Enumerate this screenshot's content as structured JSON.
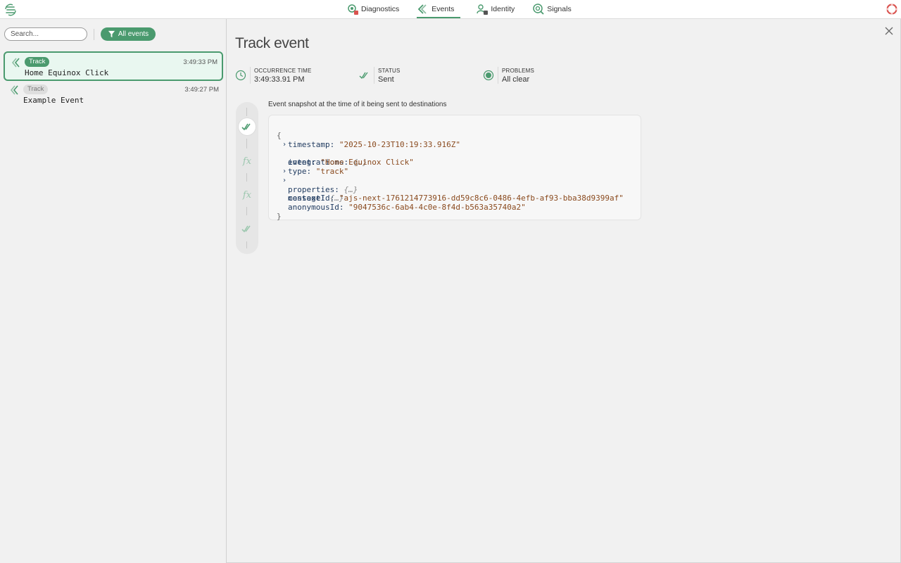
{
  "nav": {
    "items": [
      {
        "label": "Diagnostics",
        "icon": "diagnostics-icon"
      },
      {
        "label": "Events",
        "icon": "events-icon",
        "active": true
      },
      {
        "label": "Identity",
        "icon": "identity-icon"
      },
      {
        "label": "Signals",
        "icon": "signals-icon"
      }
    ]
  },
  "sidebar": {
    "search_placeholder": "Search...",
    "filter_label": "All events",
    "events": [
      {
        "type": "Track",
        "time": "3:49:33 PM",
        "name": "Home Equinox Click",
        "selected": true
      },
      {
        "type": "Track",
        "time": "3:49:27 PM",
        "name": "Example Event",
        "selected": false
      }
    ]
  },
  "detail": {
    "title": "Track event",
    "meta": [
      {
        "label": "OCCURRENCE TIME",
        "value": "3:49:33.91 PM",
        "icon": "clock-icon"
      },
      {
        "label": "STATUS",
        "value": "Sent",
        "icon": "double-check-icon"
      },
      {
        "label": "PROBLEMS",
        "value": "All clear",
        "icon": "status-dot-icon"
      }
    ],
    "snapshot_label": "Event snapshot at the time of it being sent to destinations",
    "json": {
      "open_brace": "{",
      "close_brace": "}",
      "lines": [
        {
          "key": "timestamp",
          "value": "\"2025-10-23T10:19:33.916Z\""
        },
        {
          "key": "integrations",
          "value": "{…}",
          "collapsed": true
        },
        {
          "key": "event",
          "value": "\"Home Equinox Click\""
        },
        {
          "key": "type",
          "value": "\"track\""
        },
        {
          "key": "properties",
          "value": "{…}",
          "collapsed": true
        },
        {
          "key": "context",
          "value": "{…}",
          "collapsed": true
        },
        {
          "key": "messageId",
          "value": "\"ajs-next-1761214773916-dd59c8c6-0486-4efb-af93-bba38d9399af\""
        },
        {
          "key": "anonymousId",
          "value": "\"9047536c-6ab4-4c0e-8f4d-b563a35740a2\""
        }
      ]
    },
    "pipeline": [
      "double-check-icon",
      "function-icon",
      "function-icon",
      "double-check-icon"
    ],
    "fx_glyph": "fx"
  },
  "colors": {
    "accent": "#4a9a6e",
    "accent_light": "#e9f7f0",
    "json_key": "#1f3a5f",
    "json_string": "#8a4a1e"
  }
}
